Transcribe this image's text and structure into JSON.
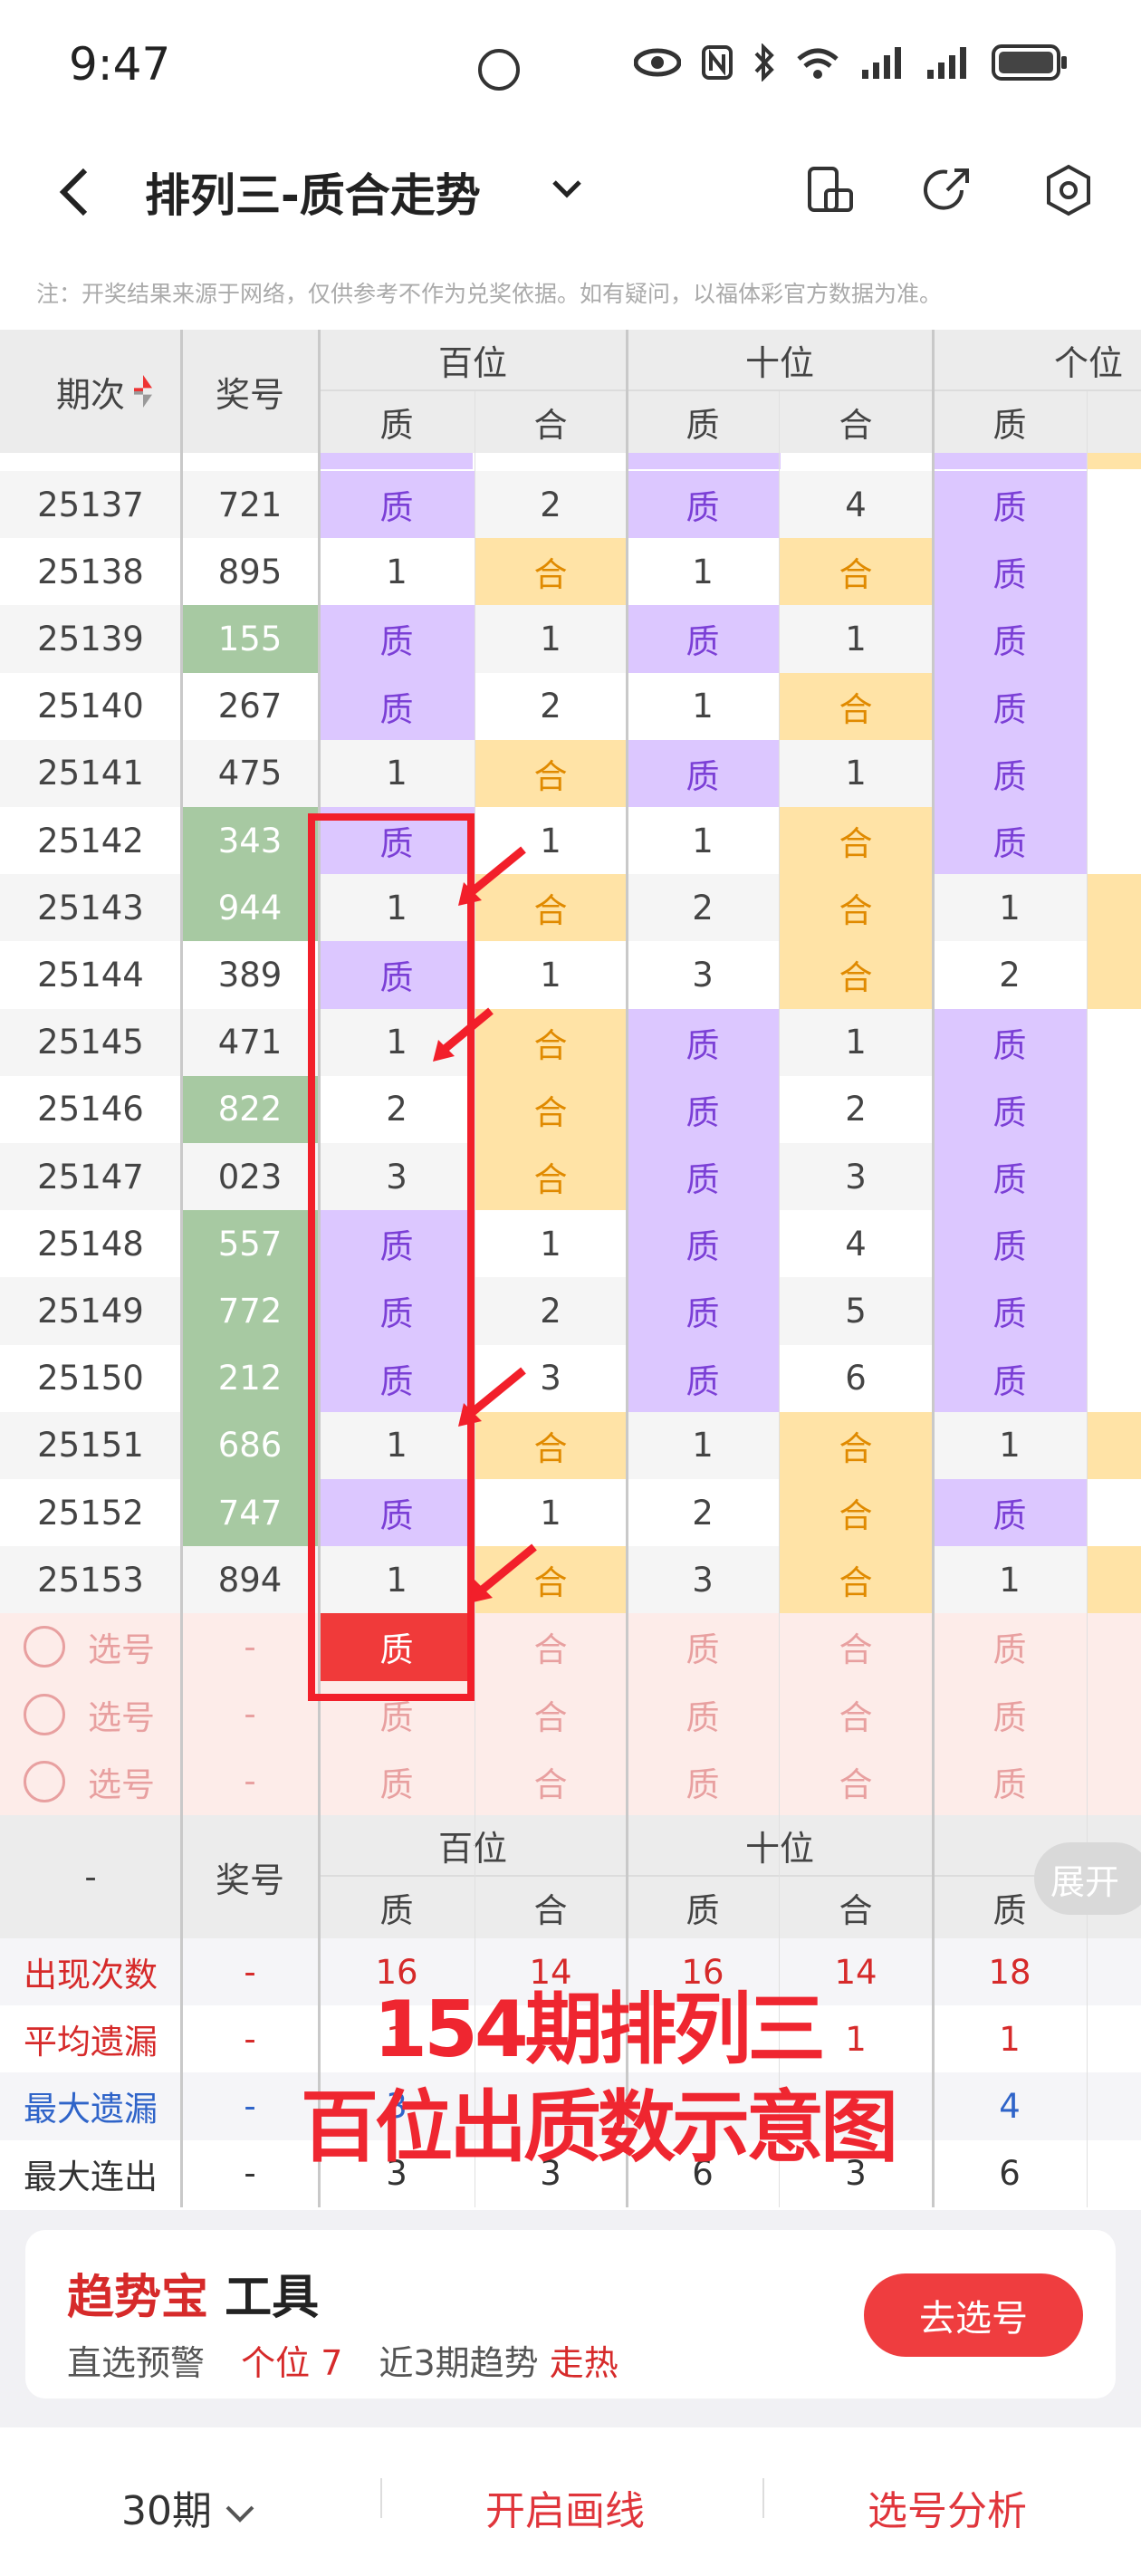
{
  "status_bar": {
    "time": "9:47"
  },
  "header": {
    "title": "排列三-质合走势"
  },
  "notice": "注：开奖结果来源于网络，仅供参考不作为兑奖依据。如有疑问，以福体彩官方数据为准。",
  "table": {
    "col_period": "期次",
    "col_number": "奖号",
    "groups": [
      "百位",
      "十位",
      "个位"
    ],
    "sub": [
      "质",
      "合",
      "质",
      "合",
      "质"
    ],
    "rows": [
      {
        "period": "25137",
        "num": "721",
        "green": false,
        "c": [
          "质",
          "2",
          "质",
          "4",
          "质"
        ]
      },
      {
        "period": "25138",
        "num": "895",
        "green": false,
        "c": [
          "1",
          "合",
          "1",
          "合",
          "质"
        ]
      },
      {
        "period": "25139",
        "num": "155",
        "green": true,
        "c": [
          "质",
          "1",
          "质",
          "1",
          "质"
        ]
      },
      {
        "period": "25140",
        "num": "267",
        "green": false,
        "c": [
          "质",
          "2",
          "1",
          "合",
          "质"
        ]
      },
      {
        "period": "25141",
        "num": "475",
        "green": false,
        "c": [
          "1",
          "合",
          "质",
          "1",
          "质"
        ]
      },
      {
        "period": "25142",
        "num": "343",
        "green": true,
        "c": [
          "质",
          "1",
          "1",
          "合",
          "质"
        ]
      },
      {
        "period": "25143",
        "num": "944",
        "green": true,
        "c": [
          "1",
          "合",
          "2",
          "合",
          "1"
        ]
      },
      {
        "period": "25144",
        "num": "389",
        "green": false,
        "c": [
          "质",
          "1",
          "3",
          "合",
          "2"
        ]
      },
      {
        "period": "25145",
        "num": "471",
        "green": false,
        "c": [
          "1",
          "合",
          "质",
          "1",
          "质"
        ]
      },
      {
        "period": "25146",
        "num": "822",
        "green": true,
        "c": [
          "2",
          "合",
          "质",
          "2",
          "质"
        ]
      },
      {
        "period": "25147",
        "num": "023",
        "green": false,
        "c": [
          "3",
          "合",
          "质",
          "3",
          "质"
        ]
      },
      {
        "period": "25148",
        "num": "557",
        "green": true,
        "c": [
          "质",
          "1",
          "质",
          "4",
          "质"
        ]
      },
      {
        "period": "25149",
        "num": "772",
        "green": true,
        "c": [
          "质",
          "2",
          "质",
          "5",
          "质"
        ]
      },
      {
        "period": "25150",
        "num": "212",
        "green": true,
        "c": [
          "质",
          "3",
          "质",
          "6",
          "质"
        ]
      },
      {
        "period": "25151",
        "num": "686",
        "green": true,
        "c": [
          "1",
          "合",
          "1",
          "合",
          "1"
        ]
      },
      {
        "period": "25152",
        "num": "747",
        "green": true,
        "c": [
          "质",
          "1",
          "2",
          "合",
          "质"
        ]
      },
      {
        "period": "25153",
        "num": "894",
        "green": false,
        "c": [
          "1",
          "合",
          "3",
          "合",
          "1"
        ]
      }
    ],
    "pick_rows": [
      {
        "label": "选号",
        "dash": "-",
        "c": [
          "质",
          "合",
          "质",
          "合",
          "质"
        ]
      },
      {
        "label": "选号",
        "dash": "-",
        "c": [
          "质",
          "合",
          "质",
          "合",
          "质"
        ]
      },
      {
        "label": "选号",
        "dash": "-",
        "c": [
          "质",
          "合",
          "质",
          "合",
          "质"
        ]
      }
    ],
    "stats_header": {
      "dash": "-",
      "col_number": "奖号"
    },
    "stats": [
      {
        "label": "出现次数",
        "dash": "-",
        "c": [
          "16",
          "14",
          "16",
          "14",
          "18"
        ],
        "color": "red"
      },
      {
        "label": "平均遗漏",
        "dash": "-",
        "c": [
          "1",
          "",
          "",
          "1",
          "1"
        ],
        "color": "red"
      },
      {
        "label": "最大遗漏",
        "dash": "-",
        "c": [
          "3",
          "",
          "",
          "",
          "4"
        ],
        "color": "blue"
      },
      {
        "label": "最大连出",
        "dash": "-",
        "c": [
          "3",
          "3",
          "6",
          "3",
          "6"
        ],
        "color": "dark"
      }
    ]
  },
  "overlay": {
    "line1": "154期排列三",
    "line2": "百位出质数示意图"
  },
  "expand_label": "展开",
  "tool_card": {
    "brand": "趋势宝",
    "suffix": "工具",
    "line_a": "直选预警",
    "line_b": "个位 7",
    "line_c": "近3期趋势",
    "line_d": "走热",
    "button": "去选号"
  },
  "bottom": {
    "periods": "30期",
    "draw": "开启画线",
    "analysis": "选号分析"
  },
  "colors": {
    "zhi_bg": "#dcc7ff",
    "he_bg": "#ffe3a6",
    "green": "#a7c9a2",
    "accent": "#ef3d3f"
  }
}
